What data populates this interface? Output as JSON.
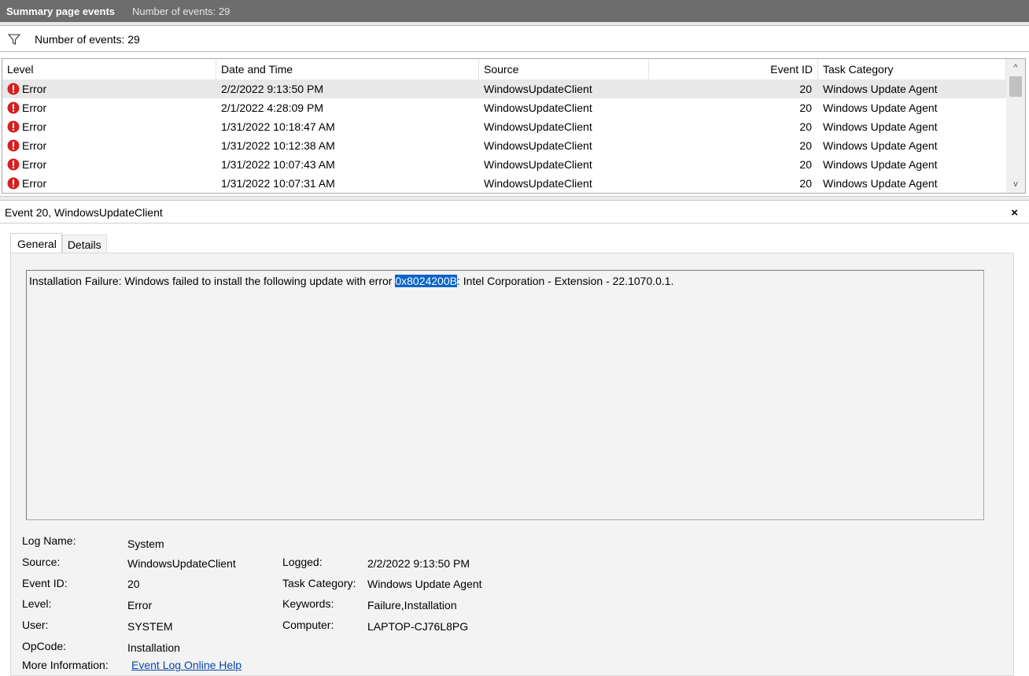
{
  "titlebar": {
    "title": "Summary page events",
    "count_text": "Number of events: 29"
  },
  "filter": {
    "label": "Number of events: 29",
    "icon": "filter-icon"
  },
  "grid": {
    "columns": [
      "Level",
      "Date and Time",
      "Source",
      "Event ID",
      "Task Category"
    ],
    "rows": [
      {
        "level": "Error",
        "datetime": "2/2/2022 9:13:50 PM",
        "source": "WindowsUpdateClient",
        "event_id": "20",
        "category": "Windows Update Agent"
      },
      {
        "level": "Error",
        "datetime": "2/1/2022 4:28:09 PM",
        "source": "WindowsUpdateClient",
        "event_id": "20",
        "category": "Windows Update Agent"
      },
      {
        "level": "Error",
        "datetime": "1/31/2022 10:18:47 AM",
        "source": "WindowsUpdateClient",
        "event_id": "20",
        "category": "Windows Update Agent"
      },
      {
        "level": "Error",
        "datetime": "1/31/2022 10:12:38 AM",
        "source": "WindowsUpdateClient",
        "event_id": "20",
        "category": "Windows Update Agent"
      },
      {
        "level": "Error",
        "datetime": "1/31/2022 10:07:43 AM",
        "source": "WindowsUpdateClient",
        "event_id": "20",
        "category": "Windows Update Agent"
      },
      {
        "level": "Error",
        "datetime": "1/31/2022 10:07:31 AM",
        "source": "WindowsUpdateClient",
        "event_id": "20",
        "category": "Windows Update Agent"
      }
    ],
    "scroll_up": "^",
    "scroll_down": "v"
  },
  "detail": {
    "header": "Event 20, WindowsUpdateClient",
    "close": "×",
    "tabs": [
      "General",
      "Details"
    ],
    "description": {
      "before": "Installation Failure: Windows failed to install the following update with error ",
      "highlight": "0x8024200B",
      "after": ": Intel Corporation - Extension - 22.1070.0.1."
    },
    "props": {
      "log_name_label": "Log Name:",
      "log_name": "System",
      "source_label": "Source:",
      "source": "WindowsUpdateClient",
      "logged_label": "Logged:",
      "logged": "2/2/2022 9:13:50 PM",
      "event_id_label": "Event ID:",
      "event_id": "20",
      "task_category_label": "Task Category:",
      "task_category": "Windows Update Agent",
      "level_label": "Level:",
      "level": "Error",
      "keywords_label": "Keywords:",
      "keywords": "Failure,Installation",
      "user_label": "User:",
      "user": "SYSTEM",
      "computer_label": "Computer:",
      "computer": "LAPTOP-CJ76L8PG",
      "opcode_label": "OpCode:",
      "opcode": "Installation",
      "more_info_label": "More Information:",
      "more_info_link": "Event Log Online Help"
    }
  },
  "colors": {
    "error_red": "#d62020",
    "selection_blue": "#0a64c8",
    "title_gray": "#6d6d6d"
  }
}
